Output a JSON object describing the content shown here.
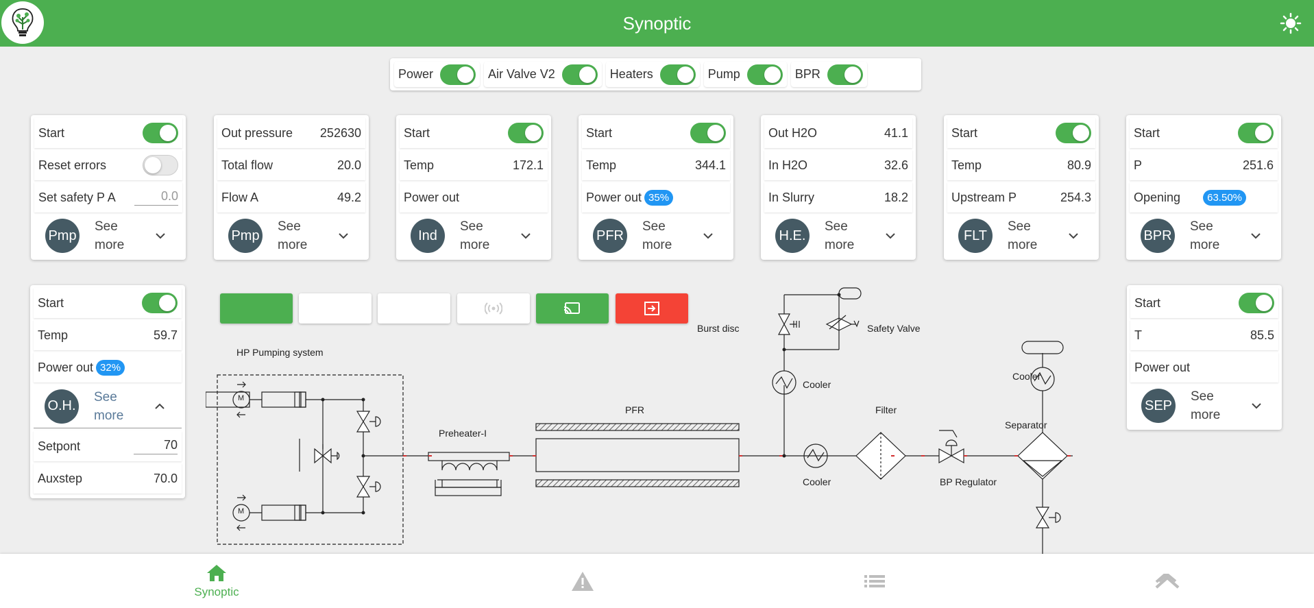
{
  "header": {
    "title": "Synoptic",
    "logo_icon": "tree-bulb-logo",
    "theme_icon": "sun-icon"
  },
  "toggles": [
    {
      "label": "Power",
      "on": true
    },
    {
      "label": "Air Valve V2",
      "on": true
    },
    {
      "label": "Heaters",
      "on": true
    },
    {
      "label": "Pump",
      "on": true
    },
    {
      "label": "BPR",
      "on": true
    }
  ],
  "cards": {
    "pmp1": {
      "start": "Start",
      "reset": "Reset errors",
      "safety": "Set safety P A",
      "safety_val": "0.0",
      "avatar": "Pmp",
      "see": "See more"
    },
    "pmp2": {
      "r1": "Out pressure",
      "v1": "252630",
      "r2": "Total flow",
      "v2": "20.0",
      "r3": "Flow A",
      "v3": "49.2",
      "avatar": "Pmp",
      "see": "See more"
    },
    "ind": {
      "start": "Start",
      "r2": "Temp",
      "v2": "172.1",
      "r3": "Power out",
      "avatar": "Ind",
      "see": "See more"
    },
    "pfr": {
      "start": "Start",
      "r2": "Temp",
      "v2": "344.1",
      "r3": "Power out",
      "badge": "35%",
      "avatar": "PFR",
      "see": "See more"
    },
    "he": {
      "r1": "Out H2O",
      "v1": "41.1",
      "r2": "In H2O",
      "v2": "32.6",
      "r3": "In Slurry",
      "v3": "18.2",
      "avatar": "H.E.",
      "see": "See more"
    },
    "flt": {
      "start": "Start",
      "r2": "Temp",
      "v2": "80.9",
      "r3": "Upstream P",
      "v3": "254.3",
      "avatar": "FLT",
      "see": "See more"
    },
    "bpr": {
      "start": "Start",
      "r2": "P",
      "v2": "251.6",
      "r3": "Opening",
      "badge": "63.50%",
      "avatar": "BPR",
      "see": "See more"
    },
    "oh": {
      "start": "Start",
      "r2": "Temp",
      "v2": "59.7",
      "r3": "Power out",
      "badge": "32%",
      "avatar": "O.H.",
      "see": "See more",
      "r4": "Setpont",
      "v4": "70",
      "r5": "Auxstep",
      "v5": "70.0"
    },
    "sep": {
      "start": "Start",
      "r2": "T",
      "v2": "85.5",
      "r3": "Power out",
      "avatar": "SEP",
      "see": "See more"
    }
  },
  "diagram": {
    "hp_pumping": "HP Pumping system",
    "preheater": "Preheater-I",
    "pfr": "PFR",
    "burst_disc": "Burst disc",
    "safety_valve": "Safety Valve",
    "cooler_top": "Cooler",
    "cooler_bottom": "Cooler",
    "filter": "Filter",
    "bp_regulator": "BP Regulator",
    "separator": "Separator",
    "cooler_right": "Cooler",
    "motor_label": "M"
  },
  "buttons": [
    {
      "name": "green-blank-button",
      "color": "#4caf50"
    },
    {
      "name": "blank-button-1",
      "color": "#ffffff"
    },
    {
      "name": "blank-button-2",
      "color": "#ffffff"
    },
    {
      "name": "wireless-button",
      "icon": "broadcast-icon",
      "color": "#ffffff"
    },
    {
      "name": "cast-button",
      "icon": "cast-icon",
      "color": "#4caf50"
    },
    {
      "name": "exit-button",
      "icon": "logout-icon",
      "color": "#f44336"
    }
  ],
  "nav": {
    "synoptic": "Synoptic",
    "icons": [
      "home-icon",
      "warning-icon",
      "list-icon",
      "collapse-icon"
    ]
  },
  "colors": {
    "primary": "#4caf50",
    "badge": "#2196f3",
    "avatar": "#455a64",
    "danger": "#f44336"
  }
}
